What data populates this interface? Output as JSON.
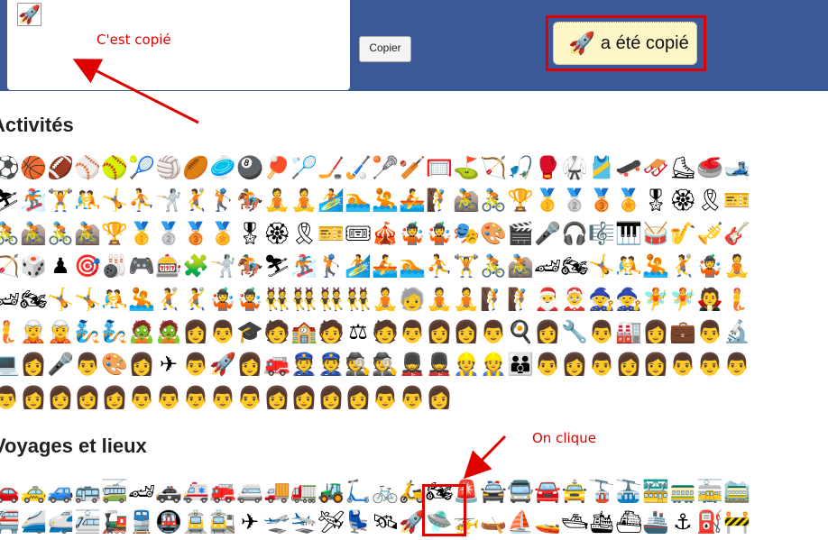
{
  "toolbar": {
    "selected_emoji": "🚀",
    "copy_label": "Copier",
    "status_emoji": "🚀",
    "status_text": "a été copié"
  },
  "annotations": {
    "copied_note": "C'est copié",
    "click_note": "On clique"
  },
  "sections": [
    {
      "title": "Activités",
      "rows": [
        [
          "⚽",
          "🏀",
          "🏈",
          "⚾",
          "🥎",
          "🎾",
          "🏐",
          "🏉",
          "🥏",
          "🎱",
          "🏓",
          "🏸",
          "🏒",
          "🏑",
          "🥍",
          "🏏",
          "🥅",
          "⛳",
          "🏹",
          "🎣",
          "🥊",
          "🥋",
          "🎽",
          "🛹",
          "🛷",
          "⛸",
          "🥌",
          "🎿"
        ],
        [
          "⛷",
          "🏂",
          "🏋",
          "🤼",
          "🤸",
          "⛹",
          "🤺",
          "🤾",
          "🏌",
          "🏇",
          "🧘",
          "🧘",
          "🏄",
          "🏊",
          "🤽",
          "🚣",
          "🧗",
          "🚵",
          "🚴",
          "🏆",
          "🥇",
          "🥈",
          "🥉",
          "🏅",
          "🎖",
          "🏵",
          "🎗",
          "🎫"
        ],
        [
          "🚴",
          "🚵",
          "🚴",
          "🚵",
          "🏆",
          "🥇",
          "🥈",
          "🥉",
          "🏅",
          "🎖",
          "🏵",
          "🎗",
          "🎫",
          "🎟",
          "🎪",
          "🤹",
          "🤹",
          "🎭",
          "🎨",
          "🎬",
          "🎤",
          "🎧",
          "🎼",
          "🎹",
          "🥁",
          "🎷",
          "🎺",
          "🎸"
        ],
        [
          "🏹",
          "🎲",
          "♟",
          "🎯",
          "🎳",
          "🎮",
          "🎰",
          "🧩",
          "🤺",
          "🏇",
          "⛷",
          "🏂",
          "🏌",
          "🏄",
          "🚣",
          "🏊",
          "⛹",
          "🏋",
          "🚴",
          "🚵",
          "🏎",
          "🏍",
          "🤸",
          "🤼",
          "🤽",
          "🤾",
          "🤹",
          "🧘"
        ],
        [
          "🏎",
          "🏍",
          "🤸",
          "🤸",
          "🤼",
          "🤽",
          "🤾",
          "🤾",
          "🤹",
          "🤹",
          "👯",
          "👯",
          "👯",
          "👯",
          "🧘",
          "🧓",
          "🧘",
          "🧘",
          "🧗",
          "🧗",
          "🎅",
          "🤶",
          "🧙",
          "🧙",
          "🧚",
          "🧚",
          "🧛",
          "🧜"
        ],
        [
          "🧜",
          "🧝",
          "🧝",
          "🧞",
          "🧞",
          "🧟",
          "🧟",
          "👩",
          "👨",
          "🎓",
          "🧑",
          "🏫",
          "🧑",
          "⚖",
          "🧑",
          "👨",
          "👩",
          "👩",
          "👨",
          "🍳",
          "👩",
          "🔧",
          "👨",
          "🏭",
          "👩",
          "💼",
          "👨",
          "🔬"
        ],
        [
          "💻",
          "👩",
          "🎤",
          "👨",
          "🎨",
          "👩",
          "✈",
          "👨",
          "🚀",
          "👩",
          "🚒",
          "👮",
          "👮",
          "🕵",
          "🕵",
          "💂",
          "💂",
          "👷",
          "👷",
          "👪",
          "👨",
          "👩",
          "👨",
          "👩",
          "👩",
          "👨",
          "👨",
          "👨"
        ],
        [
          "👨",
          "👩",
          "👩",
          "👩",
          "👩",
          "👨",
          "👨",
          "👨",
          "👨",
          "👨",
          "👩",
          "👩",
          "👩",
          "👩",
          "👨",
          "👨",
          "👩"
        ]
      ]
    },
    {
      "title": "Voyages et lieux",
      "rows": [
        [
          "🚗",
          "🚕",
          "🚙",
          "🚌",
          "🚎",
          "🏎",
          "🚓",
          "🚑",
          "🚒",
          "🚐",
          "🚚",
          "🚛",
          "🚜",
          "🛴",
          "🚲",
          "🛵",
          "🏍",
          "🚨",
          "🚔",
          "🚍",
          "🚘",
          "🚖",
          "🚡",
          "🚠",
          "🚟",
          "🚃",
          "🚋",
          "🚞"
        ],
        [
          "🚝",
          "🚄",
          "🚅",
          "🚈",
          "🚂",
          "🚆",
          "🚇",
          "🚊",
          "🚉",
          "✈",
          "🛫",
          "🛬",
          "🛩",
          "💺",
          "🛰",
          "🚀",
          "🛸",
          "🚁",
          "🛶",
          "⛵",
          "🚤",
          "🛥",
          "🛳",
          "⛴",
          "🚢",
          "⚓",
          "⛽",
          "🚧"
        ]
      ]
    }
  ]
}
